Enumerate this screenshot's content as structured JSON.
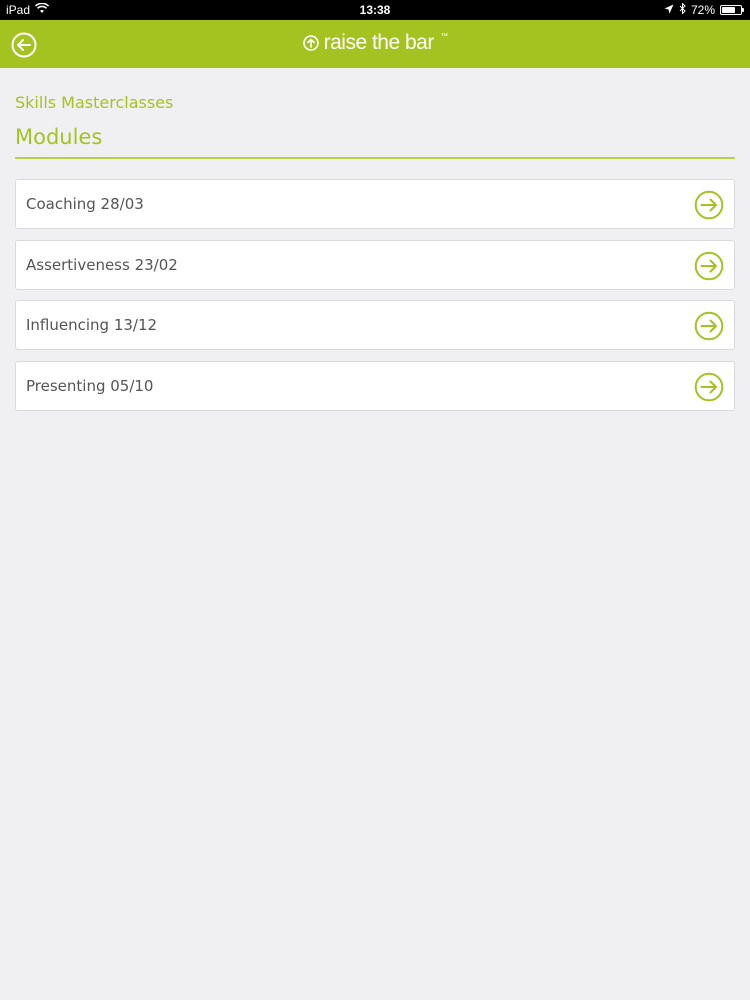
{
  "status_bar": {
    "device": "iPad",
    "time": "13:38",
    "battery": "72%",
    "battery_level": 0.72
  },
  "nav": {
    "brand": "raise the bar",
    "trademark": "™"
  },
  "page": {
    "breadcrumb": "Skills Masterclasses",
    "title": "Modules"
  },
  "modules": [
    {
      "label": "Coaching 28/03"
    },
    {
      "label": "Assertiveness 23/02"
    },
    {
      "label": "Influencing 13/12"
    },
    {
      "label": "Presenting 05/10"
    }
  ],
  "colors": {
    "brand_green": "#a4c321"
  }
}
